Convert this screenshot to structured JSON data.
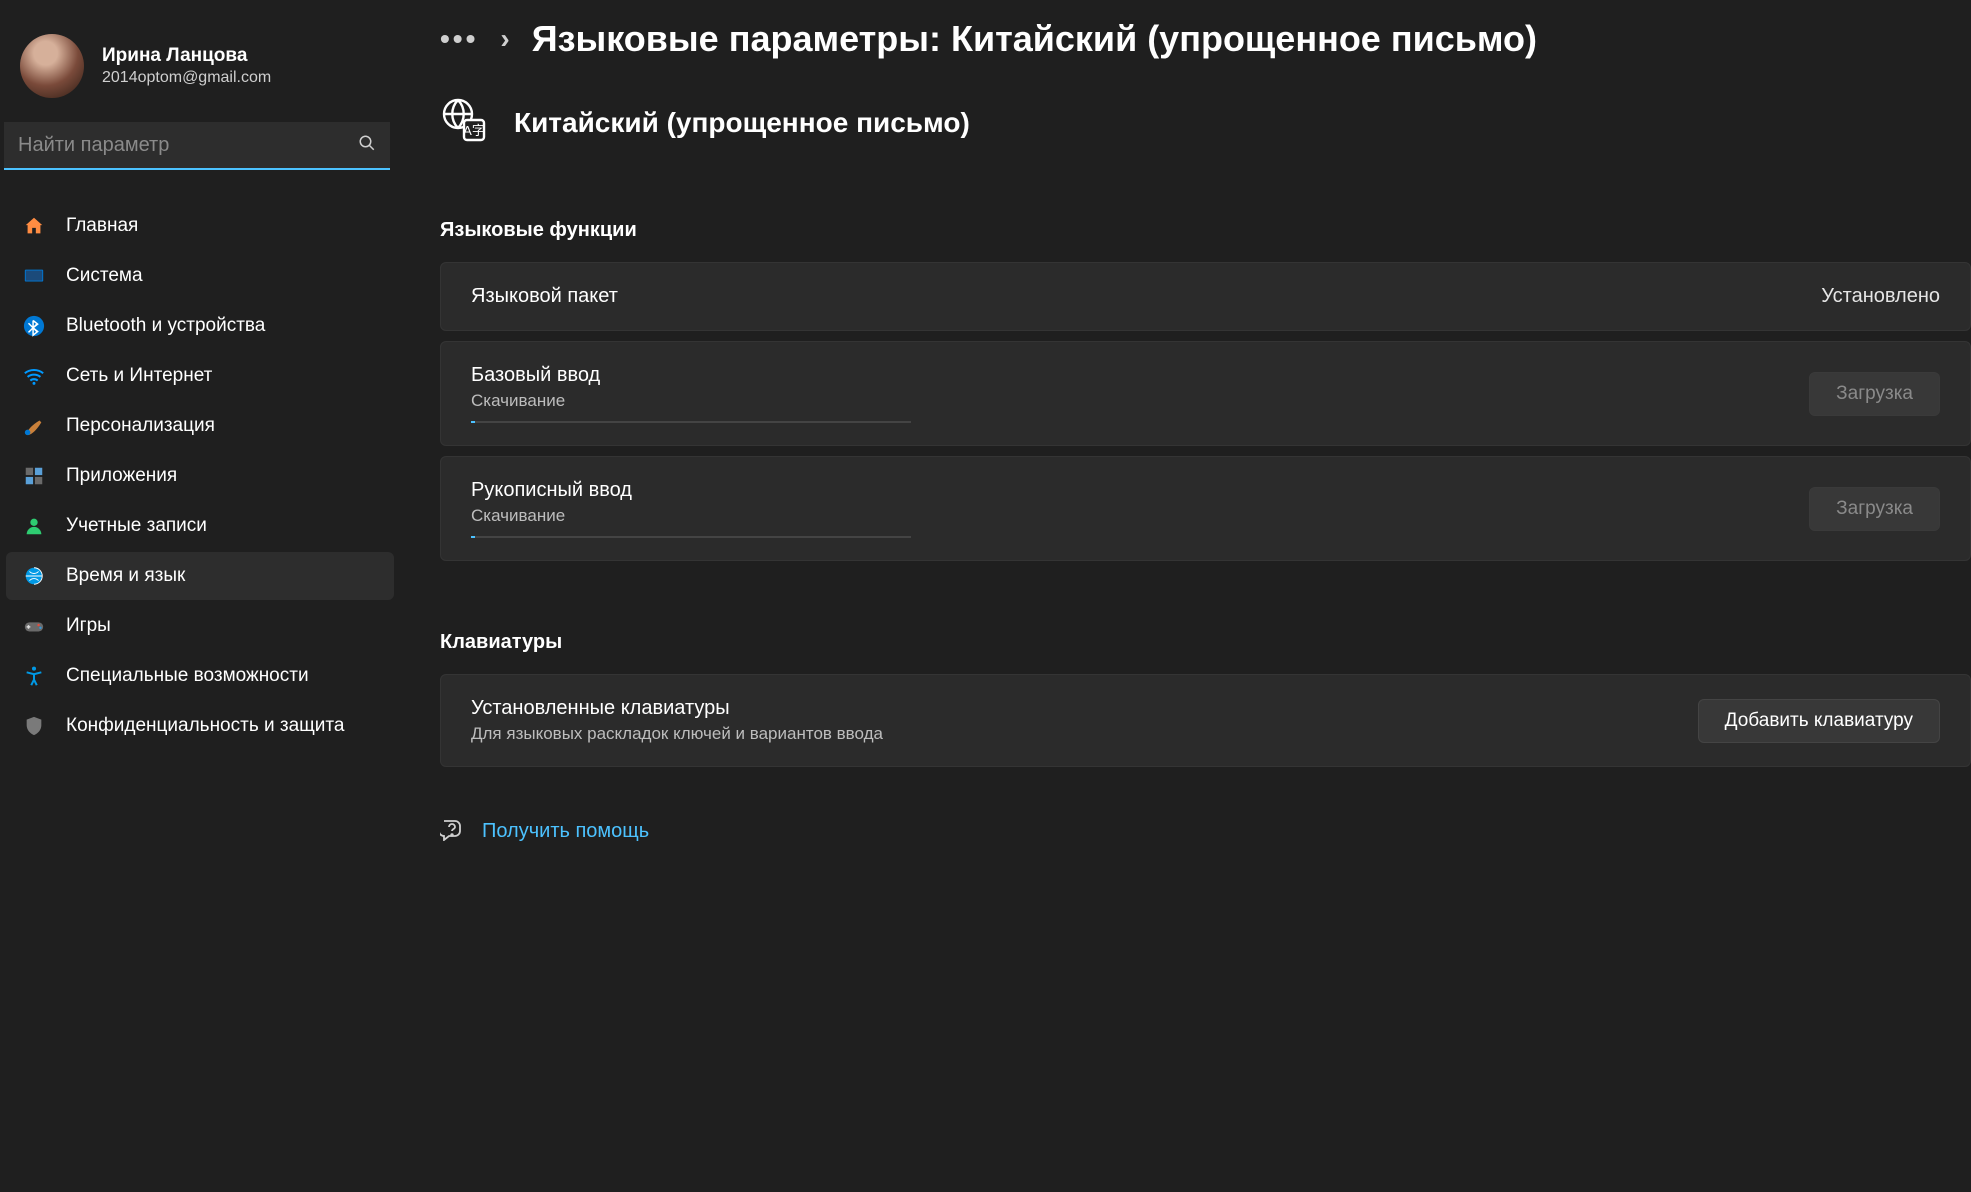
{
  "profile": {
    "name": "Ирина Ланцова",
    "email": "2014optom@gmail.com"
  },
  "search": {
    "placeholder": "Найти параметр"
  },
  "nav": {
    "items": [
      {
        "label": "Главная",
        "icon": "home"
      },
      {
        "label": "Система",
        "icon": "system"
      },
      {
        "label": "Bluetooth и устройства",
        "icon": "bluetooth"
      },
      {
        "label": "Сеть и Интернет",
        "icon": "wifi"
      },
      {
        "label": "Персонализация",
        "icon": "brush"
      },
      {
        "label": "Приложения",
        "icon": "apps"
      },
      {
        "label": "Учетные записи",
        "icon": "person"
      },
      {
        "label": "Время и язык",
        "icon": "globe-clock",
        "active": true
      },
      {
        "label": "Игры",
        "icon": "gamepad"
      },
      {
        "label": "Специальные возможности",
        "icon": "accessibility"
      },
      {
        "label": "Конфиденциальность и защита",
        "icon": "shield"
      }
    ]
  },
  "breadcrumb": {
    "title": "Языковые параметры: Китайский (упрощенное письмо)"
  },
  "language": {
    "name": "Китайский (упрощенное письмо)"
  },
  "sections": {
    "features_title": "Языковые функции",
    "keyboards_title": "Клавиатуры"
  },
  "features": [
    {
      "title": "Языковой пакет",
      "status": "Установлено"
    },
    {
      "title": "Базовый ввод",
      "sub": "Скачивание",
      "button": "Загрузка",
      "downloading": true
    },
    {
      "title": "Рукописный ввод",
      "sub": "Скачивание",
      "button": "Загрузка",
      "downloading": true
    }
  ],
  "keyboards": {
    "title": "Установленные клавиатуры",
    "sub": "Для языковых раскладок ключей и вариантов ввода",
    "button": "Добавить клавиатуру"
  },
  "help": {
    "label": "Получить помощь"
  }
}
